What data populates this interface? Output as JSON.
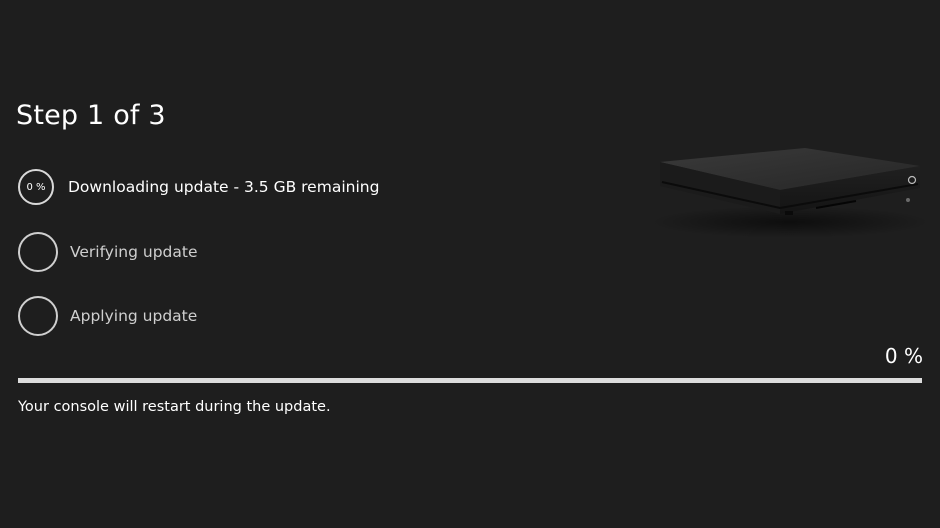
{
  "header": {
    "step_title": "Step 1 of 3"
  },
  "steps": [
    {
      "badge": "0 %",
      "label": "Downloading update - 3.5 GB remaining",
      "state": "active"
    },
    {
      "badge": "",
      "label": "Verifying update",
      "state": "pending"
    },
    {
      "badge": "",
      "label": "Applying update",
      "state": "pending"
    }
  ],
  "progress": {
    "percent_label": "0 %",
    "fraction": 0
  },
  "footer": {
    "note": "Your console will restart during the update."
  },
  "image": {
    "icon": "console-icon"
  },
  "colors": {
    "background": "#1e1e1e",
    "text": "#ffffff",
    "muted_text": "#cfcfcf",
    "track": "#dcdcdc"
  }
}
